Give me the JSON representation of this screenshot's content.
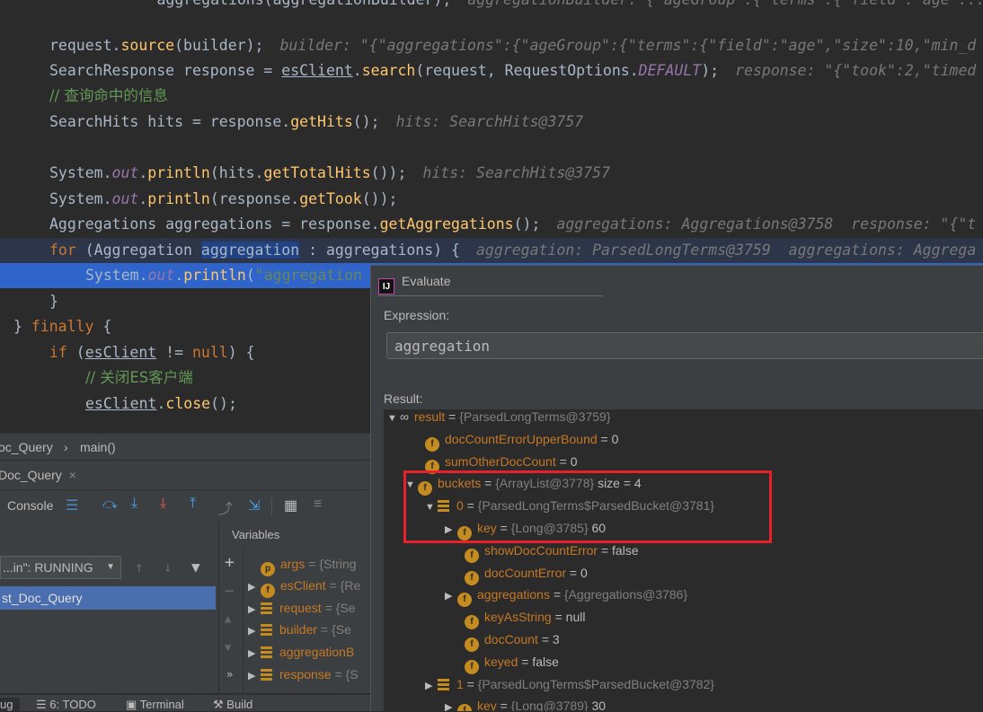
{
  "editor": {
    "line0": {
      "code": "        aggregations(aggregationBuilder);",
      "hint": "aggregationBuilder: {\"ageGroup\":{\"terms\":{\"field\":\"age\"..."
    },
    "line1": {
      "a": "request.",
      "m": "source",
      "b": "(builder);",
      "hint": "builder: \"{\"aggregations\":{\"ageGroup\":{\"terms\":{\"field\":\"age\",\"size\":10,\"min_d"
    },
    "line2": {
      "a": "SearchResponse response = ",
      "obj": "esClient",
      "b": ".",
      "m": "search",
      "c": "(request, RequestOptions.",
      "st": "DEFAULT",
      "d": ");",
      "hint": "response: \"{\"took\":2,\"timed"
    },
    "line3": {
      "comment": "// 查询命中的信息"
    },
    "line4": {
      "a": "SearchHits hits = response.",
      "m": "getHits",
      "b": "();",
      "hint": "hits: SearchHits@3757"
    },
    "line5": {
      "a": "System.",
      "st": "out",
      "b": ".",
      "m1": "println",
      "c": "(hits.",
      "m2": "getTotalHits",
      "d": "());",
      "hint": "hits: SearchHits@3757"
    },
    "line6": {
      "a": "System.",
      "st": "out",
      "b": ".",
      "m1": "println",
      "c": "(response.",
      "m2": "getTook",
      "d": "());"
    },
    "line7": {
      "a": "Aggregations aggregations = response.",
      "m": "getAggregations",
      "b": "();",
      "hint": "aggregations: Aggregations@3758  response: \"{\"t"
    },
    "line8": {
      "kw": "for",
      "a": " (Aggregation ",
      "sel": "aggregation",
      "b": " : aggregations) {",
      "hint": "aggregation: ParsedLongTerms@3759  aggregations: Aggrega"
    },
    "line9": {
      "a": "System.",
      "st": "out",
      "b": ".",
      "m": "println",
      "c": "(",
      "s": "\"aggregation"
    },
    "line10": {
      "code": "}"
    },
    "line11": {
      "a": "} ",
      "kw": "finally",
      "b": " {"
    },
    "line12": {
      "kw": "if",
      "a": " (",
      "obj": "esClient",
      "b": " != ",
      "kw2": "null",
      "c": ") {"
    },
    "line13": {
      "comment": "// 关闭ES客户端"
    },
    "line14": {
      "obj": "esClient",
      "a": ".",
      "m": "close",
      "b": "();"
    }
  },
  "breadcrumb": {
    "class_name": "oc_Query",
    "separator": "›",
    "method": "main()"
  },
  "debug_tab": {
    "label": "Doc_Query",
    "close": "×"
  },
  "toolbar": {
    "console_label": "Console"
  },
  "thread_select": {
    "value": "...in\": RUNNING"
  },
  "frames": {
    "selected": "st_Doc_Query"
  },
  "variables": {
    "title": "Variables",
    "items": [
      {
        "badge": "p",
        "name": "args",
        "value": "= {String"
      },
      {
        "badge": "f",
        "name": "esClient",
        "value": "= {Re"
      },
      {
        "badge": "list",
        "name": "request",
        "value": "= {Se"
      },
      {
        "badge": "list",
        "name": "builder",
        "value": "= {Se"
      },
      {
        "badge": "list",
        "name": "aggregationB",
        "value": ""
      },
      {
        "badge": "list",
        "name": "response",
        "value": "= {S"
      }
    ]
  },
  "bottom_tabs": {
    "debug": "ug",
    "todo": "6: TODO",
    "terminal": "Terminal",
    "build": "Build"
  },
  "evaluate": {
    "title": "Evaluate",
    "expression_label": "Expression:",
    "expression": "aggregation",
    "result_label": "Result:",
    "tree": [
      {
        "name": "result",
        "type": "{ParsedLongTerms@3759}",
        "value": ""
      },
      {
        "name": "docCountErrorUpperBound",
        "type": "",
        "value": "0"
      },
      {
        "name": "sumOtherDocCount",
        "type": "",
        "value": "0"
      },
      {
        "name": "buckets",
        "type": "{ArrayList@3778}",
        "value": "size = 4"
      },
      {
        "name": "0",
        "type": "{ParsedLongTerms$ParsedBucket@3781}",
        "value": ""
      },
      {
        "name": "key",
        "type": "{Long@3785}",
        "value": "60"
      },
      {
        "name": "showDocCountError",
        "type": "",
        "value": "false"
      },
      {
        "name": "docCountError",
        "type": "",
        "value": "0"
      },
      {
        "name": "aggregations",
        "type": "{Aggregations@3786}",
        "value": ""
      },
      {
        "name": "keyAsString",
        "type": "",
        "value": "null"
      },
      {
        "name": "docCount",
        "type": "",
        "value": "3"
      },
      {
        "name": "keyed",
        "type": "",
        "value": "false"
      },
      {
        "name": "1",
        "type": "{ParsedLongTerms$ParsedBucket@3782}",
        "value": ""
      },
      {
        "name": "key",
        "type": "{Long@3789}",
        "value": "30"
      }
    ]
  },
  "colors": {
    "highlight_box": "#e8202a",
    "exec_line": "#2f65ca",
    "selection": "#214283"
  }
}
